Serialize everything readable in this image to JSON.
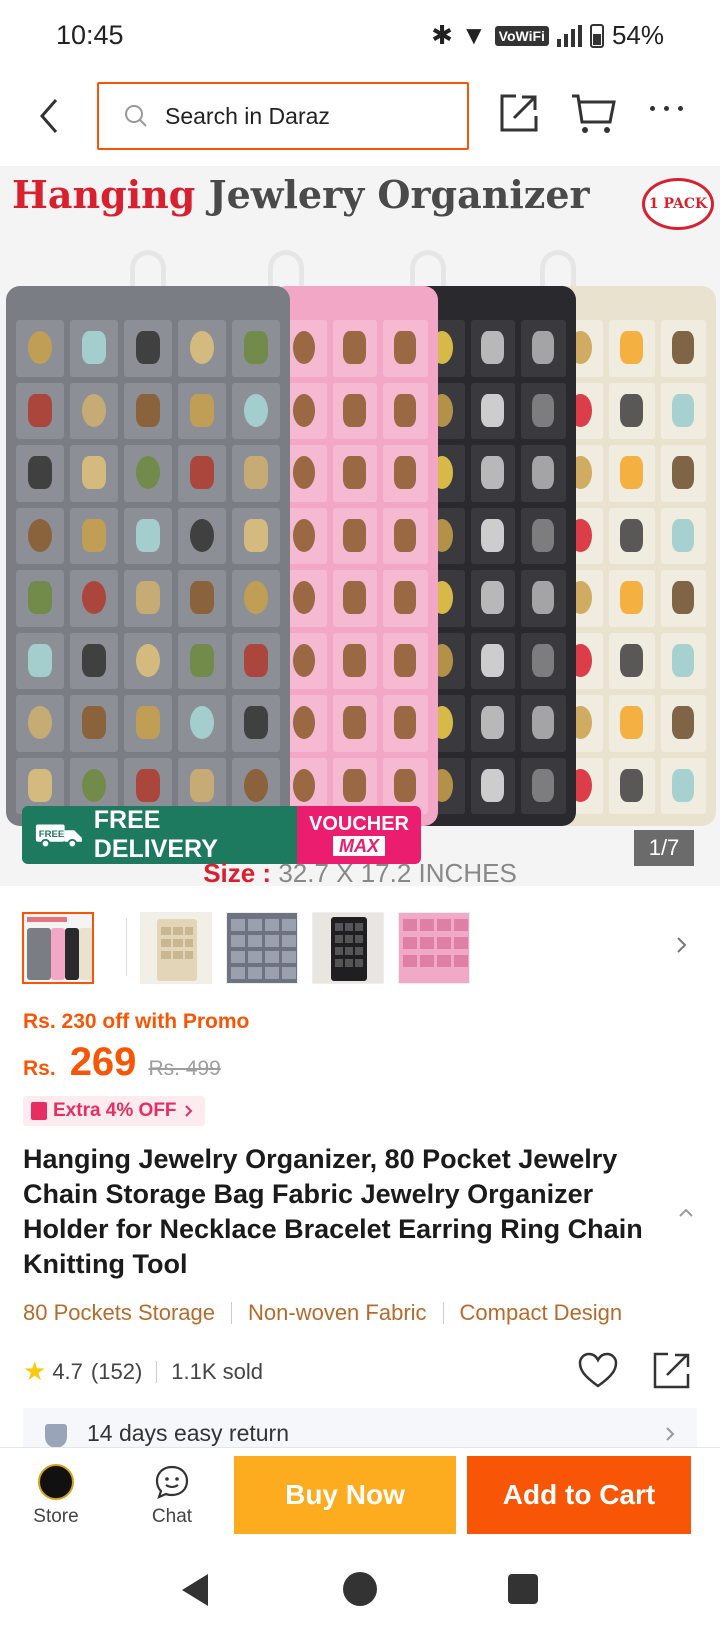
{
  "status": {
    "time": "10:45",
    "network_badge": "VoWiFi",
    "battery": "54%"
  },
  "header": {
    "search_placeholder": "Search in Daraz"
  },
  "gallery": {
    "hero_title_highlight": "Hanging",
    "hero_title_rest": " Jewlery Organizer",
    "pack_badge": "1 PACK",
    "size_label": "Size :",
    "size_value": " 32.7 X 17.2 INCHES",
    "free_delivery_badge": "FREE",
    "free_delivery": "FREE DELIVERY",
    "voucher_line1": "VOUCHER",
    "voucher_line2": "MAX",
    "counter": "1/7",
    "thumbnail_count": 5,
    "active_thumbnail": 1
  },
  "pricing": {
    "promo": "Rs. 230 off with Promo",
    "currency": "Rs.",
    "price": "269",
    "original_price": "Rs. 499",
    "extra_off": "Extra 4% OFF"
  },
  "product": {
    "title": "Hanging Jewelry Organizer, 80 Pocket Jewelry Chain Storage Bag Fabric Jewelry Organizer Holder for Necklace Bracelet Earring Ring Chain Knitting Tool",
    "features": [
      "80 Pockets Storage",
      "Non-woven Fabric",
      "Compact Design"
    ],
    "rating": "4.7",
    "review_count": "(152)",
    "sold": "1.1K sold",
    "return_policy": "14 days easy return"
  },
  "bottom_bar": {
    "store_label": "Store",
    "chat_label": "Chat",
    "buy_now": "Buy Now",
    "add_to_cart": "Add to Cart"
  },
  "colors": {
    "accent": "#f85606",
    "buy_now": "#fcac1e",
    "free_delivery": "#1d7a5f",
    "voucher": "#ea1d6f",
    "feature_text": "#b66b2c",
    "star": "#faca0f"
  }
}
